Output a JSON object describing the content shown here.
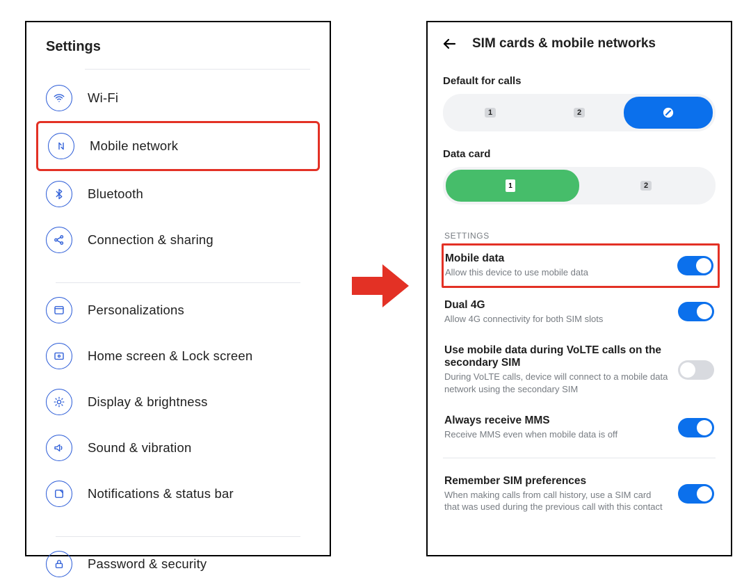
{
  "left": {
    "title": "Settings",
    "items": {
      "wifi": "Wi-Fi",
      "mobile_network": "Mobile network",
      "bluetooth": "Bluetooth",
      "connection_sharing": "Connection & sharing",
      "personalizations": "Personalizations",
      "home_lock": "Home screen & Lock screen",
      "display": "Display & brightness",
      "sound": "Sound & vibration",
      "notifications": "Notifications & status bar",
      "password": "Password & security"
    }
  },
  "right": {
    "title": "SIM cards & mobile networks",
    "default_calls": {
      "label": "Default for calls",
      "opt1": "1",
      "opt2": "2"
    },
    "data_card": {
      "label": "Data card",
      "opt1": "1",
      "opt2": "2"
    },
    "section_label": "SETTINGS",
    "rows": {
      "mobile_data": {
        "title": "Mobile data",
        "sub": "Allow this device to use mobile data",
        "on": true
      },
      "dual_4g": {
        "title": "Dual 4G",
        "sub": "Allow 4G connectivity for both SIM slots",
        "on": true
      },
      "volte": {
        "title": "Use mobile data during VoLTE calls on the secondary SIM",
        "sub": "During VoLTE calls, device will connect to a mobile data network using the secondary SIM",
        "on": false
      },
      "mms": {
        "title": "Always receive MMS",
        "sub": "Receive MMS even when mobile data is off",
        "on": true
      },
      "sim_pref": {
        "title": "Remember SIM preferences",
        "sub": "When making calls from call history, use a SIM card that was used during the previous call with this contact",
        "on": true
      }
    }
  },
  "colors": {
    "accent": "#1a73e8",
    "highlight": "#e33125",
    "green": "#46bd6a"
  }
}
